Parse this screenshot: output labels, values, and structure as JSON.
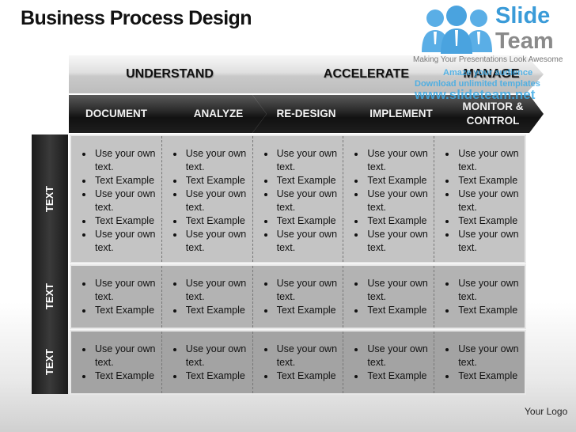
{
  "title": "Business Process Design",
  "logo": {
    "name_line1": "Slide",
    "name_line2": "Team",
    "tagline": "Making Your Presentations Look Awesome",
    "colors": {
      "primary": "#3a9bd8",
      "secondary": "#8a8a8a"
    }
  },
  "watermark": {
    "line1": "Amaze your audience",
    "line2": "Download unlimited templates",
    "line3": "www.slideteam.net"
  },
  "phases": [
    "UNDERSTAND",
    "ACCELERATE",
    "MANAGE"
  ],
  "steps": [
    "DOCUMENT",
    "ANALYZE",
    "RE-DESIGN",
    "IMPLEMENT",
    "MONITOR & CONTROL"
  ],
  "rows": [
    {
      "label": "TEXT",
      "cells": [
        [
          "Use your own text.",
          "Text Example",
          "Use your own text.",
          "Text Example",
          "Use your own text."
        ],
        [
          "Use your own text.",
          "Text Example",
          "Use your own text.",
          "Text Example",
          "Use your own text."
        ],
        [
          "Use your own text.",
          "Text Example",
          "Use your own text.",
          "Text Example",
          "Use your own text."
        ],
        [
          "Use your own text.",
          "Text Example",
          "Use your own text.",
          "Text Example",
          "Use your own text."
        ],
        [
          "Use your own text.",
          "Text Example",
          "Use your own text.",
          "Text Example",
          "Use your own text."
        ]
      ]
    },
    {
      "label": "TEXT",
      "cells": [
        [
          "Use your own text.",
          "Text Example"
        ],
        [
          "Use your own text.",
          "Text Example"
        ],
        [
          "Use your own text.",
          "Text Example"
        ],
        [
          "Use your own text.",
          "Text Example"
        ],
        [
          "Use your own text.",
          "Text Example"
        ]
      ]
    },
    {
      "label": "TEXT",
      "cells": [
        [
          "Use your own text.",
          "Text Example"
        ],
        [
          "Use your own text.",
          "Text Example"
        ],
        [
          "Use your own text.",
          "Text Example"
        ],
        [
          "Use your own text.",
          "Text Example"
        ],
        [
          "Use your own text.",
          "Text Example"
        ]
      ]
    }
  ],
  "footer": {
    "logo_text": "Your Logo"
  }
}
